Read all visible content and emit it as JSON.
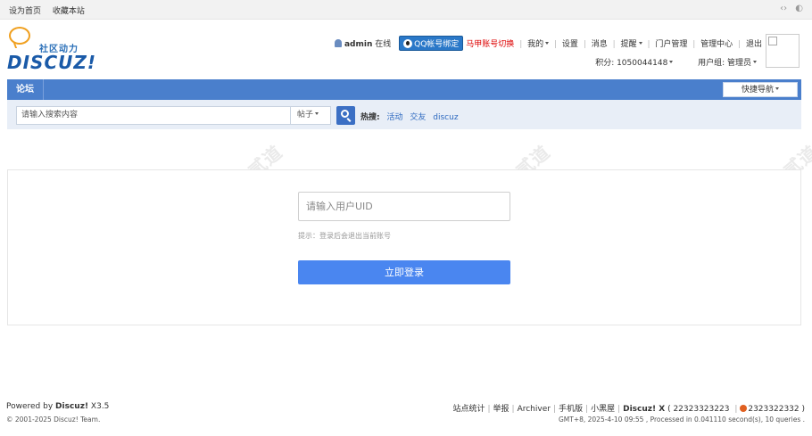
{
  "topbar": {
    "set_home": "设为首页",
    "bookmark": "收藏本站",
    "icons": [
      "code-icon",
      "palette-icon"
    ]
  },
  "logo": {
    "cn": "社区动力",
    "en": "DISCUZ!"
  },
  "usernav": {
    "username": "admin",
    "online": "在线",
    "qq_bind": "QQ帐号绑定",
    "switch_account": "马甲账号切换",
    "mine": "我的",
    "settings": "设置",
    "messages": "消息",
    "remind": "提醒",
    "portal_manage": "门户管理",
    "admin_center": "管理中心",
    "logout": "退出"
  },
  "credits": {
    "points": "积分: 1050044148",
    "usergroup": "用户组: 管理员"
  },
  "nav": {
    "forum": "论坛",
    "quick_nav": "快捷导航"
  },
  "search": {
    "placeholder": "请输入搜索内容",
    "type": "帖子",
    "hot_label": "热搜:",
    "hot_items": [
      "活动",
      "交友",
      "discuz"
    ]
  },
  "main": {
    "uid_placeholder": "请输入用户UID",
    "tip": "提示：登录后会退出当前账号",
    "login_button": "立即登录"
  },
  "footer": {
    "powered_prefix": "Powered by",
    "powered_brand": "Discuz!",
    "version": "X3.5",
    "copyright": "© 2001-2025 Discuz! Team.",
    "links": [
      "站点统计",
      "举报",
      "Archiver",
      "手机版",
      "小黑屋"
    ],
    "brand": "Discuz! X",
    "qq1": "( 22323323223",
    "qq2": "2323322332 )",
    "stats": "GMT+8, 2025-4-10 09:55 , Processed in 0.041110 second(s), 10 queries ."
  },
  "colors": {
    "nav_bg": "#4a7fcc",
    "search_bg": "#e8eef7",
    "login_button": "#4a86f0",
    "link": "#2f6ac0",
    "alert": "#dd0000"
  }
}
